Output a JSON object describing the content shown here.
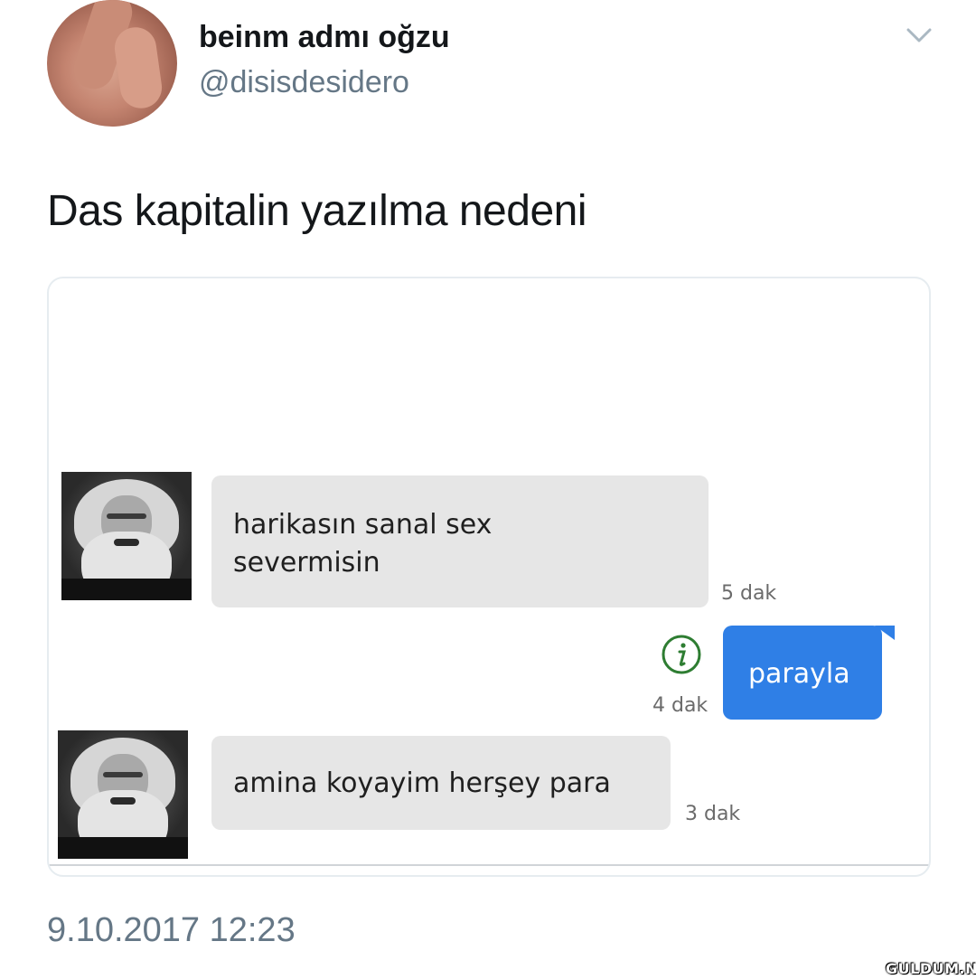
{
  "tweet": {
    "display_name": "beinm admı oğzu",
    "handle": "@disisdesidero",
    "text": "Das kapitalin yazılma nedeni",
    "timestamp": "9.10.2017 12:23",
    "menu_icon": "chevron-down-icon"
  },
  "chat": {
    "messages": [
      {
        "direction": "incoming",
        "lines": [
          "harikasın sanal sex",
          "severmisin"
        ],
        "time": "5 dak",
        "avatar": "karl-marx-portrait"
      },
      {
        "direction": "outgoing",
        "lines": [
          "parayla"
        ],
        "time": "4 dak",
        "icon": "info-icon"
      },
      {
        "direction": "incoming",
        "lines": [
          "amina koyayim herşey para"
        ],
        "time": "3 dak",
        "avatar": "karl-marx-portrait"
      }
    ],
    "colors": {
      "incoming_bubble": "#e6e6e6",
      "outgoing_bubble": "#2f7fe6",
      "info_icon": "#2e7d32"
    }
  },
  "watermark": "GULDUM.NET"
}
